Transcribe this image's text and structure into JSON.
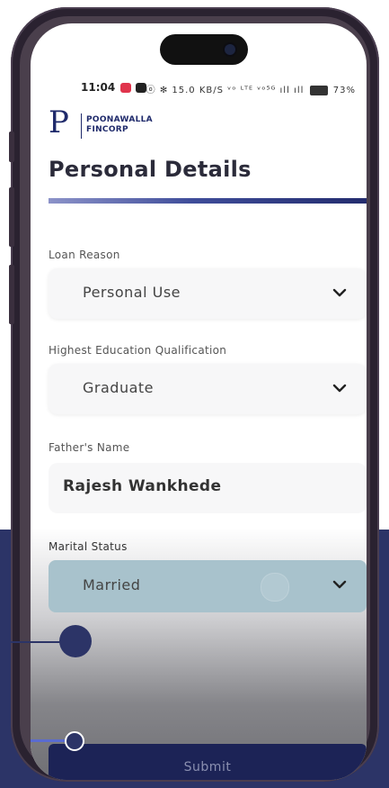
{
  "status_bar": {
    "time": "11:04",
    "right_icons": "ⓞ ✻ 15.0 KB/S ᵛᵒ ᴸᵀᴱ ᵛᵒ⁵ᴳ ıll ıll",
    "battery_level": 73,
    "battery_text": "73%"
  },
  "logo": {
    "mark": "P",
    "line1": "POONAWALLA",
    "line2": "FINCORP"
  },
  "page": {
    "title": "Personal Details"
  },
  "form": {
    "loan_reason": {
      "label": "Loan Reason",
      "value": "Personal Use"
    },
    "education": {
      "label": "Highest Education Qualification",
      "value": "Graduate"
    },
    "father_name": {
      "label": "Father's Name",
      "value": "Rajesh Wankhede"
    },
    "marital_status": {
      "label": "Marital Status",
      "value": "Married"
    }
  },
  "submit": {
    "label": "Submit"
  },
  "colors": {
    "brand": "#1f2a6b",
    "background_block": "#2c3467",
    "submit_bg": "#1c2356",
    "selected_field": "#a8c2cc"
  },
  "icons": [
    "chevron-down-icon",
    "status-app-icon",
    "battery-icon",
    "callout-dot",
    "slider-knob"
  ]
}
